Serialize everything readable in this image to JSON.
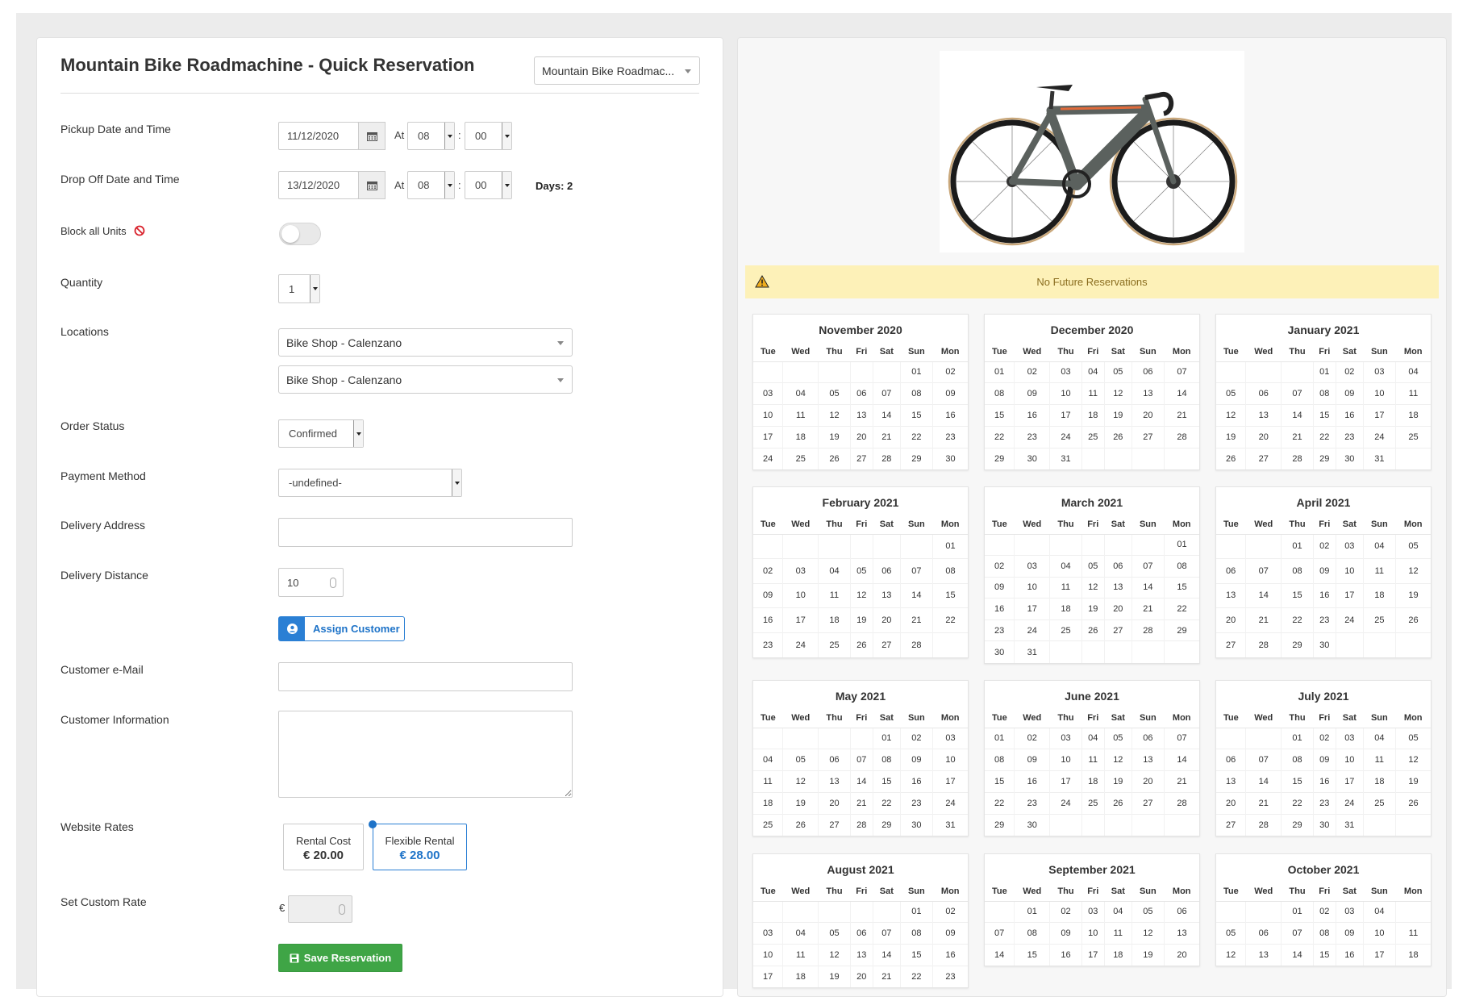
{
  "form": {
    "title": "Mountain Bike Roadmachine - Quick Reservation",
    "product_select": "Mountain Bike Roadmac...",
    "pickup_label": "Pickup Date and Time",
    "pickup_date": "11/12/2020",
    "pickup_hour": "08",
    "pickup_min": "00",
    "dropoff_label": "Drop Off Date and Time",
    "dropoff_date": "13/12/2020",
    "dropoff_hour": "08",
    "dropoff_min": "00",
    "at_label": "At",
    "colon": ":",
    "days_text": "Days: 2",
    "block_label": "Block all Units",
    "quantity_label": "Quantity",
    "quantity": "1",
    "locations_label": "Locations",
    "location_pickup": "Bike Shop - Calenzano",
    "location_dropoff": "Bike Shop - Calenzano",
    "order_status_label": "Order Status",
    "order_status": "Confirmed",
    "payment_label": "Payment Method",
    "payment": "-undefined-",
    "delivery_address_label": "Delivery Address",
    "delivery_distance_label": "Delivery Distance",
    "delivery_distance": "10",
    "assign_customer": "Assign Customer",
    "email_label": "Customer e-Mail",
    "info_label": "Customer Information",
    "website_rates_label": "Website Rates",
    "rate1_label": "Rental Cost",
    "rate1_value": "€ 20.00",
    "rate2_label": "Flexible Rental",
    "rate2_value": "€ 28.00",
    "custom_rate_label": "Set Custom Rate",
    "currency": "€",
    "save": "Save Reservation"
  },
  "alert": {
    "text": "No Future Reservations"
  },
  "colors": {
    "accent": "#1e73c8",
    "save": "#3fa546",
    "alert_bg": "#fdf1b8"
  },
  "weekdays": [
    "Tue",
    "Wed",
    "Thu",
    "Fri",
    "Sat",
    "Sun",
    "Mon"
  ],
  "calendars": [
    {
      "name": "November 2020",
      "rows": [
        [
          "",
          "",
          "",
          "",
          "",
          "01",
          "02"
        ],
        [
          "03",
          "04",
          "05",
          "06",
          "07",
          "08",
          "09"
        ],
        [
          "10",
          "11",
          "12",
          "13",
          "14",
          "15",
          "16"
        ],
        [
          "17",
          "18",
          "19",
          "20",
          "21",
          "22",
          "23"
        ],
        [
          "24",
          "25",
          "26",
          "27",
          "28",
          "29",
          "30"
        ]
      ]
    },
    {
      "name": "December 2020",
      "rows": [
        [
          "01",
          "02",
          "03",
          "04",
          "05",
          "06",
          "07"
        ],
        [
          "08",
          "09",
          "10",
          "11",
          "12",
          "13",
          "14"
        ],
        [
          "15",
          "16",
          "17",
          "18",
          "19",
          "20",
          "21"
        ],
        [
          "22",
          "23",
          "24",
          "25",
          "26",
          "27",
          "28"
        ],
        [
          "29",
          "30",
          "31",
          "",
          "",
          "",
          ""
        ]
      ]
    },
    {
      "name": "January 2021",
      "rows": [
        [
          "",
          "",
          "",
          "01",
          "02",
          "03",
          "04"
        ],
        [
          "05",
          "06",
          "07",
          "08",
          "09",
          "10",
          "11"
        ],
        [
          "12",
          "13",
          "14",
          "15",
          "16",
          "17",
          "18"
        ],
        [
          "19",
          "20",
          "21",
          "22",
          "23",
          "24",
          "25"
        ],
        [
          "26",
          "27",
          "28",
          "29",
          "30",
          "31",
          ""
        ]
      ]
    },
    {
      "name": "February 2021",
      "rows": [
        [
          "",
          "",
          "",
          "",
          "",
          "",
          "01"
        ],
        [
          "02",
          "03",
          "04",
          "05",
          "06",
          "07",
          "08"
        ],
        [
          "09",
          "10",
          "11",
          "12",
          "13",
          "14",
          "15"
        ],
        [
          "16",
          "17",
          "18",
          "19",
          "20",
          "21",
          "22"
        ],
        [
          "23",
          "24",
          "25",
          "26",
          "27",
          "28",
          ""
        ]
      ]
    },
    {
      "name": "March 2021",
      "rows": [
        [
          "",
          "",
          "",
          "",
          "",
          "",
          "01"
        ],
        [
          "02",
          "03",
          "04",
          "05",
          "06",
          "07",
          "08"
        ],
        [
          "09",
          "10",
          "11",
          "12",
          "13",
          "14",
          "15"
        ],
        [
          "16",
          "17",
          "18",
          "19",
          "20",
          "21",
          "22"
        ],
        [
          "23",
          "24",
          "25",
          "26",
          "27",
          "28",
          "29"
        ],
        [
          "30",
          "31",
          "",
          "",
          "",
          "",
          ""
        ]
      ]
    },
    {
      "name": "April 2021",
      "rows": [
        [
          "",
          "",
          "01",
          "02",
          "03",
          "04",
          "05"
        ],
        [
          "06",
          "07",
          "08",
          "09",
          "10",
          "11",
          "12"
        ],
        [
          "13",
          "14",
          "15",
          "16",
          "17",
          "18",
          "19"
        ],
        [
          "20",
          "21",
          "22",
          "23",
          "24",
          "25",
          "26"
        ],
        [
          "27",
          "28",
          "29",
          "30",
          "",
          "",
          ""
        ]
      ]
    },
    {
      "name": "May 2021",
      "rows": [
        [
          "",
          "",
          "",
          "",
          "01",
          "02",
          "03"
        ],
        [
          "04",
          "05",
          "06",
          "07",
          "08",
          "09",
          "10"
        ],
        [
          "11",
          "12",
          "13",
          "14",
          "15",
          "16",
          "17"
        ],
        [
          "18",
          "19",
          "20",
          "21",
          "22",
          "23",
          "24"
        ],
        [
          "25",
          "26",
          "27",
          "28",
          "29",
          "30",
          "31"
        ]
      ]
    },
    {
      "name": "June 2021",
      "rows": [
        [
          "01",
          "02",
          "03",
          "04",
          "05",
          "06",
          "07"
        ],
        [
          "08",
          "09",
          "10",
          "11",
          "12",
          "13",
          "14"
        ],
        [
          "15",
          "16",
          "17",
          "18",
          "19",
          "20",
          "21"
        ],
        [
          "22",
          "23",
          "24",
          "25",
          "26",
          "27",
          "28"
        ],
        [
          "29",
          "30",
          "",
          "",
          "",
          "",
          ""
        ]
      ]
    },
    {
      "name": "July 2021",
      "rows": [
        [
          "",
          "",
          "01",
          "02",
          "03",
          "04",
          "05"
        ],
        [
          "06",
          "07",
          "08",
          "09",
          "10",
          "11",
          "12"
        ],
        [
          "13",
          "14",
          "15",
          "16",
          "17",
          "18",
          "19"
        ],
        [
          "20",
          "21",
          "22",
          "23",
          "24",
          "25",
          "26"
        ],
        [
          "27",
          "28",
          "29",
          "30",
          "31",
          "",
          ""
        ]
      ]
    },
    {
      "name": "August 2021",
      "rows": [
        [
          "",
          "",
          "",
          "",
          "",
          "01",
          "02"
        ],
        [
          "03",
          "04",
          "05",
          "06",
          "07",
          "08",
          "09"
        ],
        [
          "10",
          "11",
          "12",
          "13",
          "14",
          "15",
          "16"
        ],
        [
          "17",
          "18",
          "19",
          "20",
          "21",
          "22",
          "23"
        ]
      ]
    },
    {
      "name": "September 2021",
      "rows": [
        [
          "",
          "01",
          "02",
          "03",
          "04",
          "05",
          "06"
        ],
        [
          "07",
          "08",
          "09",
          "10",
          "11",
          "12",
          "13"
        ],
        [
          "14",
          "15",
          "16",
          "17",
          "18",
          "19",
          "20"
        ]
      ]
    },
    {
      "name": "October 2021",
      "rows": [
        [
          "",
          "",
          "01",
          "02",
          "03",
          "04"
        ],
        [
          "05",
          "06",
          "07",
          "08",
          "09",
          "10",
          "11"
        ],
        [
          "12",
          "13",
          "14",
          "15",
          "16",
          "17",
          "18"
        ]
      ]
    }
  ]
}
